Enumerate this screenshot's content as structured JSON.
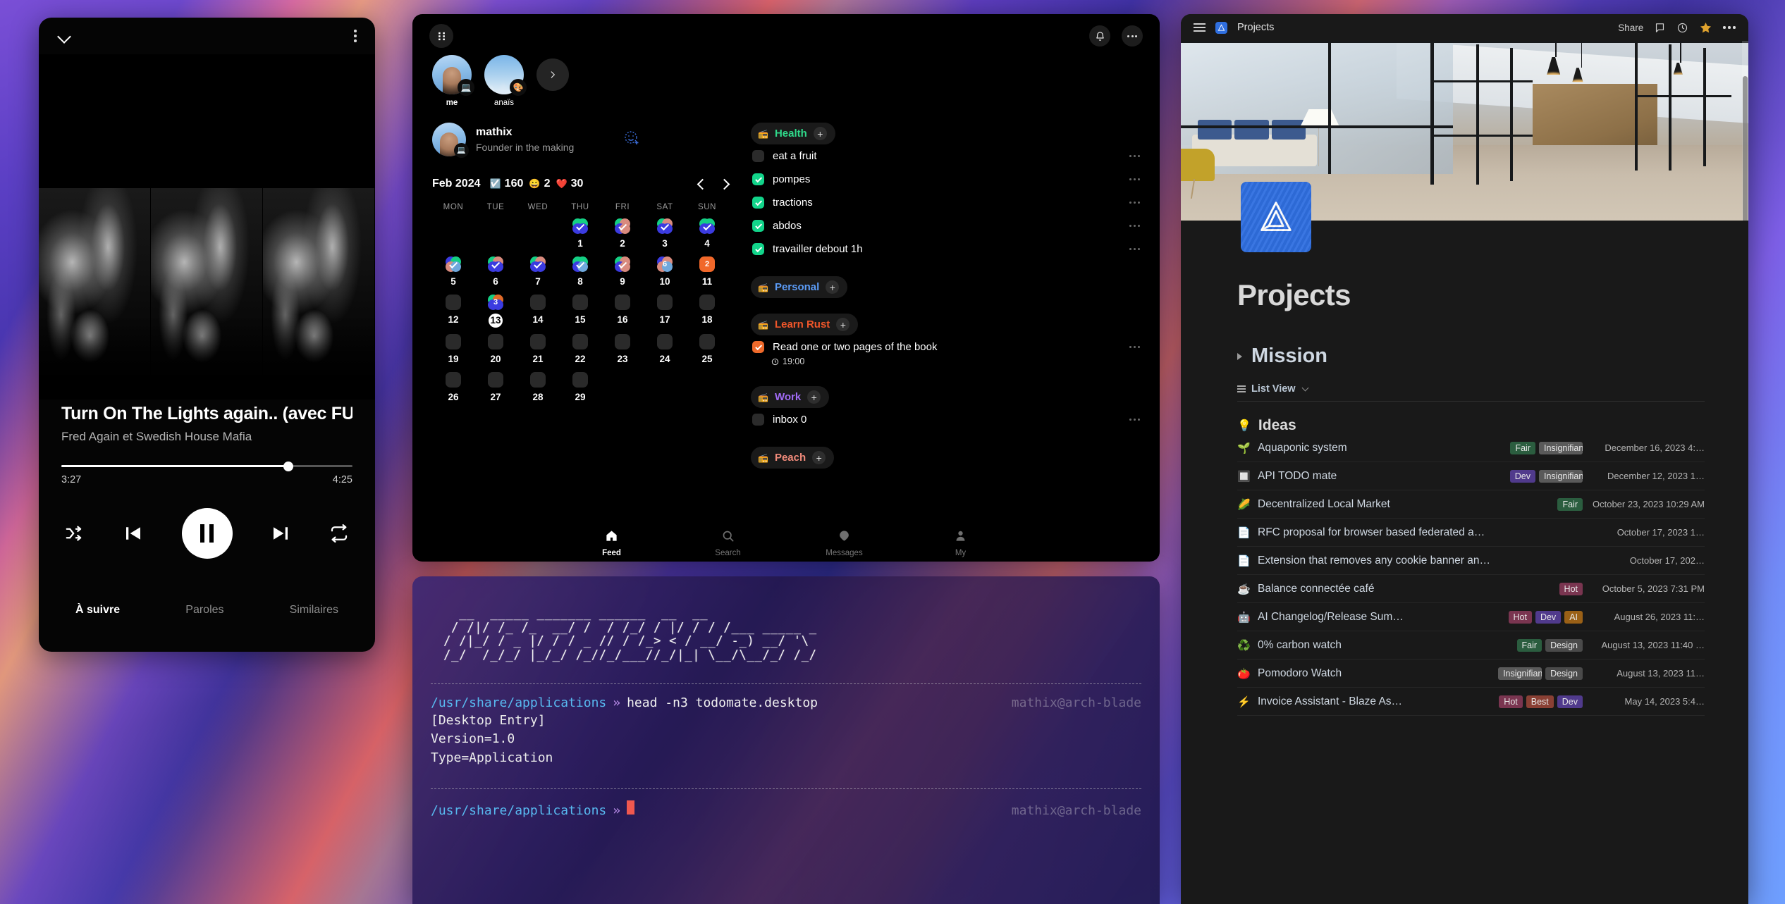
{
  "music_player": {
    "collapse_icon": "chevron-down-icon",
    "menu_icon": "kebab-menu-icon",
    "track_title": "Turn On The Lights again.. (avec FU…",
    "artist": "Fred Again et Swedish House Mafia",
    "elapsed": "3:27",
    "duration": "4:25",
    "progress_percent": 78,
    "controls": {
      "shuffle": "shuffle-icon",
      "previous": "previous-track-icon",
      "play_pause": "pause-icon",
      "next": "next-track-icon",
      "repeat": "repeat-icon"
    },
    "tabs": [
      {
        "label": "À suivre",
        "active": true
      },
      {
        "label": "Paroles",
        "active": false
      },
      {
        "label": "Similaires",
        "active": false
      }
    ]
  },
  "todo_app": {
    "notification_icon": "bell-icon",
    "more_icon": "kebab-menu-icon",
    "stories": [
      {
        "name": "me",
        "badge": "💻",
        "bold": true
      },
      {
        "name": "anaïs",
        "badge": "🎨",
        "bold": false
      }
    ],
    "next_story_icon": "chevron-right-icon",
    "profile": {
      "name": "mathix",
      "subtitle": "Founder in the making",
      "badge": "💻",
      "add_reaction_icon": "add-emoji-icon"
    },
    "calendar": {
      "month": "Feb 2024",
      "stats": [
        {
          "icon": "☑️",
          "value": "160"
        },
        {
          "icon": "😀",
          "value": "2"
        },
        {
          "icon": "❤️",
          "value": "30"
        }
      ],
      "prev_icon": "chevron-left-icon",
      "next_icon": "chevron-right-icon",
      "dow": [
        "MON",
        "TUE",
        "WED",
        "THU",
        "FRI",
        "SAT",
        "SUN"
      ],
      "leading_blanks": 3,
      "days": [
        {
          "n": "1",
          "state": "tick",
          "colors": [
            "#14cf84",
            "#14cf84",
            "#3b3be0",
            "#3b3be0"
          ]
        },
        {
          "n": "2",
          "state": "tick",
          "colors": [
            "#14cf84",
            "#d98b7e",
            "#3b3be0",
            "#d98b7e"
          ]
        },
        {
          "n": "3",
          "state": "tick",
          "colors": [
            "#14cf84",
            "#d98b7e",
            "#3b3be0",
            "#3b3be0"
          ]
        },
        {
          "n": "4",
          "state": "tick",
          "colors": [
            "#14cf84",
            "#14cf84",
            "#3b3be0",
            "#3b3be0"
          ]
        },
        {
          "n": "5",
          "state": "tick",
          "colors": [
            "#3b3be0",
            "#14cf84",
            "#d98b7e",
            "#6fa8dc"
          ]
        },
        {
          "n": "6",
          "state": "tick",
          "colors": [
            "#14cf84",
            "#d98b7e",
            "#3b3be0",
            "#3b3be0"
          ]
        },
        {
          "n": "7",
          "state": "tick",
          "colors": [
            "#14cf84",
            "#d98b7e",
            "#3b3be0",
            "#3b3be0"
          ]
        },
        {
          "n": "8",
          "state": "tick",
          "colors": [
            "#14cf84",
            "#14cf84",
            "#3b3be0",
            "#6fa8dc"
          ]
        },
        {
          "n": "9",
          "state": "tick",
          "colors": [
            "#14cf84",
            "#d98b7e",
            "#3b3be0",
            "#d98b7e"
          ]
        },
        {
          "n": "10",
          "state": "count",
          "count": "6",
          "colors": [
            "#3b3be0",
            "#d98b7e",
            "#d98b7e",
            "#6fa8dc"
          ]
        },
        {
          "n": "11",
          "state": "solid",
          "count": "2"
        },
        {
          "n": "12",
          "state": "empty"
        },
        {
          "n": "13",
          "state": "count",
          "count": "3",
          "today": true,
          "colors": [
            "#14cf84",
            "#e06a28",
            "#3b3be0",
            "#3b3be0"
          ]
        },
        {
          "n": "14",
          "state": "empty"
        },
        {
          "n": "15",
          "state": "empty"
        },
        {
          "n": "16",
          "state": "empty"
        },
        {
          "n": "17",
          "state": "empty"
        },
        {
          "n": "18",
          "state": "empty"
        },
        {
          "n": "19",
          "state": "empty"
        },
        {
          "n": "20",
          "state": "empty"
        },
        {
          "n": "21",
          "state": "empty"
        },
        {
          "n": "22",
          "state": "empty"
        },
        {
          "n": "23",
          "state": "empty"
        },
        {
          "n": "24",
          "state": "empty"
        },
        {
          "n": "25",
          "state": "empty"
        },
        {
          "n": "26",
          "state": "empty"
        },
        {
          "n": "27",
          "state": "empty"
        },
        {
          "n": "28",
          "state": "empty"
        },
        {
          "n": "29",
          "state": "empty"
        }
      ]
    },
    "groups": [
      {
        "name": "Health",
        "color": "#2fd98a",
        "icon": "📻",
        "add_label": "+",
        "tasks": [
          {
            "label": "eat a fruit",
            "done": false
          },
          {
            "label": "pompes",
            "done": true
          },
          {
            "label": "tractions",
            "done": true
          },
          {
            "label": "abdos",
            "done": true
          },
          {
            "label": "travailler debout 1h",
            "done": true
          }
        ]
      },
      {
        "name": "Personal",
        "color": "#5b9bf5",
        "icon": "📻",
        "add_label": "+",
        "tasks": []
      },
      {
        "name": "Learn Rust",
        "color": "#f0562a",
        "icon": "📻",
        "add_label": "+",
        "tasks": [
          {
            "label": "Read one or two pages of the book",
            "done": true,
            "accent": "orange",
            "time": "19:00"
          }
        ]
      },
      {
        "name": "Work",
        "color": "#a06bf5",
        "icon": "📻",
        "add_label": "+",
        "tasks": [
          {
            "label": "inbox 0",
            "done": false
          }
        ]
      },
      {
        "name": "Peach",
        "color": "#f08a7a",
        "icon": "📻",
        "add_label": "+",
        "tasks": []
      }
    ],
    "bottom_nav": [
      {
        "label": "Feed",
        "icon": "home-icon",
        "active": true
      },
      {
        "label": "Search",
        "icon": "search-icon",
        "active": false
      },
      {
        "label": "Messages",
        "icon": "message-icon",
        "active": false
      },
      {
        "label": "My",
        "icon": "person-icon",
        "active": false
      }
    ]
  },
  "terminal": {
    "ascii_art": "  __  _____ _______ ______  __  __\n / /|/ /_ /_  __/ /  / /_/ / |/ / / /___ _____ _\n/ /|_/ / _ |/ / / _ // / /_> < / __/ -_) __/ '\\\n/_/  /_/_/ |_/_/ /_//_/___//_/|_| \\__/\\__/_/ /_/",
    "lines": [
      {
        "path": "/usr/share/applications",
        "arrow": "»",
        "command": "head -n3 todomate.desktop",
        "host": "mathix@arch-blade",
        "output": "[Desktop Entry]\nVersion=1.0\nType=Application"
      },
      {
        "path": "/usr/share/applications",
        "arrow": "»",
        "command": "",
        "host": "mathix@arch-blade",
        "output": ""
      }
    ]
  },
  "notion": {
    "menu_icon": "hamburger-menu-icon",
    "workspace_icon": "penrose-triangle-icon",
    "breadcrumb": "Projects",
    "share_label": "Share",
    "comment_icon": "comment-icon",
    "history_icon": "clock-icon",
    "favorite_icon": "star-icon",
    "more_icon": "kebab-menu-icon",
    "page_icon": "penrose-triangle-icon",
    "page_title": "Projects",
    "mission_heading": "Mission",
    "view_label": "List View",
    "view_icon": "list-view-icon",
    "section_heading": "Ideas",
    "section_emoji": "💡",
    "ideas": [
      {
        "emoji": "🌱",
        "name": "Aquaponic system",
        "tags": [
          {
            "t": "Fair",
            "c": "fair"
          },
          {
            "t": "Insignifiant",
            "c": "insig"
          }
        ],
        "date": "December 16, 2023 4:…"
      },
      {
        "emoji": "🔲",
        "name": "API TODO mate",
        "tags": [
          {
            "t": "Dev",
            "c": "dev"
          },
          {
            "t": "Insignifiant",
            "c": "insig"
          }
        ],
        "date": "December 12, 2023 1…"
      },
      {
        "emoji": "🌽",
        "name": "Decentralized Local Market",
        "tags": [
          {
            "t": "Fair",
            "c": "fair"
          }
        ],
        "date": "October 23, 2023 10:29 AM"
      },
      {
        "emoji": "📄",
        "name": "RFC proposal for browser based federated a…",
        "tags": [],
        "date": "October 17, 2023 1…"
      },
      {
        "emoji": "📄",
        "name": "Extension that removes any cookie banner and …",
        "tags": [],
        "date": "October 17, 202…"
      },
      {
        "emoji": "☕",
        "name": "Balance connectée café",
        "tags": [
          {
            "t": "Hot",
            "c": "hot"
          }
        ],
        "date": "October 5, 2023 7:31 PM"
      },
      {
        "emoji": "🤖",
        "name": "AI Changelog/Release Sum…",
        "tags": [
          {
            "t": "Hot",
            "c": "hot"
          },
          {
            "t": "Dev",
            "c": "dev"
          },
          {
            "t": "AI",
            "c": "ai"
          }
        ],
        "date": "August 26, 2023 11:…"
      },
      {
        "emoji": "♻️",
        "name": "0% carbon watch",
        "tags": [
          {
            "t": "Fair",
            "c": "fair"
          },
          {
            "t": "Design",
            "c": "design"
          }
        ],
        "date": "August 13, 2023 11:40 …"
      },
      {
        "emoji": "🍅",
        "name": "Pomodoro Watch",
        "tags": [
          {
            "t": "Insignifiant",
            "c": "insig"
          },
          {
            "t": "Design",
            "c": "design"
          }
        ],
        "date": "August 13, 2023 11…"
      },
      {
        "emoji": "⚡",
        "name": "Invoice Assistant - Blaze As…",
        "tags": [
          {
            "t": "Hot",
            "c": "hot"
          },
          {
            "t": "Best",
            "c": "best"
          },
          {
            "t": "Dev",
            "c": "dev"
          }
        ],
        "date": "May 14, 2023 5:4…"
      }
    ]
  }
}
